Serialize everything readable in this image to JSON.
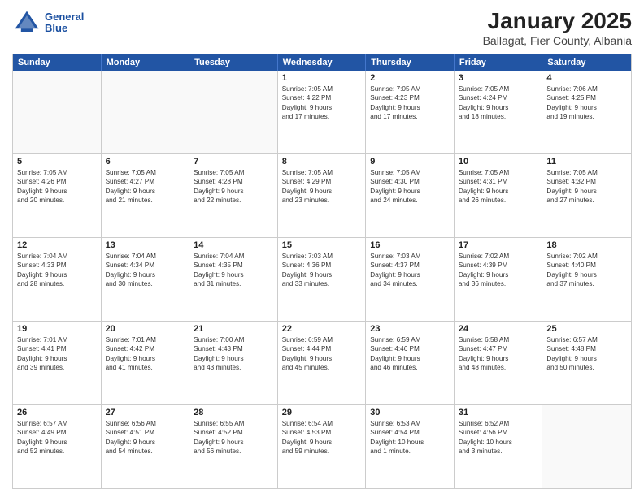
{
  "logo": {
    "line1": "General",
    "line2": "Blue"
  },
  "title": "January 2025",
  "subtitle": "Ballagat, Fier County, Albania",
  "days": [
    "Sunday",
    "Monday",
    "Tuesday",
    "Wednesday",
    "Thursday",
    "Friday",
    "Saturday"
  ],
  "rows": [
    [
      {
        "day": "",
        "info": ""
      },
      {
        "day": "",
        "info": ""
      },
      {
        "day": "",
        "info": ""
      },
      {
        "day": "1",
        "info": "Sunrise: 7:05 AM\nSunset: 4:22 PM\nDaylight: 9 hours\nand 17 minutes."
      },
      {
        "day": "2",
        "info": "Sunrise: 7:05 AM\nSunset: 4:23 PM\nDaylight: 9 hours\nand 17 minutes."
      },
      {
        "day": "3",
        "info": "Sunrise: 7:05 AM\nSunset: 4:24 PM\nDaylight: 9 hours\nand 18 minutes."
      },
      {
        "day": "4",
        "info": "Sunrise: 7:06 AM\nSunset: 4:25 PM\nDaylight: 9 hours\nand 19 minutes."
      }
    ],
    [
      {
        "day": "5",
        "info": "Sunrise: 7:05 AM\nSunset: 4:26 PM\nDaylight: 9 hours\nand 20 minutes."
      },
      {
        "day": "6",
        "info": "Sunrise: 7:05 AM\nSunset: 4:27 PM\nDaylight: 9 hours\nand 21 minutes."
      },
      {
        "day": "7",
        "info": "Sunrise: 7:05 AM\nSunset: 4:28 PM\nDaylight: 9 hours\nand 22 minutes."
      },
      {
        "day": "8",
        "info": "Sunrise: 7:05 AM\nSunset: 4:29 PM\nDaylight: 9 hours\nand 23 minutes."
      },
      {
        "day": "9",
        "info": "Sunrise: 7:05 AM\nSunset: 4:30 PM\nDaylight: 9 hours\nand 24 minutes."
      },
      {
        "day": "10",
        "info": "Sunrise: 7:05 AM\nSunset: 4:31 PM\nDaylight: 9 hours\nand 26 minutes."
      },
      {
        "day": "11",
        "info": "Sunrise: 7:05 AM\nSunset: 4:32 PM\nDaylight: 9 hours\nand 27 minutes."
      }
    ],
    [
      {
        "day": "12",
        "info": "Sunrise: 7:04 AM\nSunset: 4:33 PM\nDaylight: 9 hours\nand 28 minutes."
      },
      {
        "day": "13",
        "info": "Sunrise: 7:04 AM\nSunset: 4:34 PM\nDaylight: 9 hours\nand 30 minutes."
      },
      {
        "day": "14",
        "info": "Sunrise: 7:04 AM\nSunset: 4:35 PM\nDaylight: 9 hours\nand 31 minutes."
      },
      {
        "day": "15",
        "info": "Sunrise: 7:03 AM\nSunset: 4:36 PM\nDaylight: 9 hours\nand 33 minutes."
      },
      {
        "day": "16",
        "info": "Sunrise: 7:03 AM\nSunset: 4:37 PM\nDaylight: 9 hours\nand 34 minutes."
      },
      {
        "day": "17",
        "info": "Sunrise: 7:02 AM\nSunset: 4:39 PM\nDaylight: 9 hours\nand 36 minutes."
      },
      {
        "day": "18",
        "info": "Sunrise: 7:02 AM\nSunset: 4:40 PM\nDaylight: 9 hours\nand 37 minutes."
      }
    ],
    [
      {
        "day": "19",
        "info": "Sunrise: 7:01 AM\nSunset: 4:41 PM\nDaylight: 9 hours\nand 39 minutes."
      },
      {
        "day": "20",
        "info": "Sunrise: 7:01 AM\nSunset: 4:42 PM\nDaylight: 9 hours\nand 41 minutes."
      },
      {
        "day": "21",
        "info": "Sunrise: 7:00 AM\nSunset: 4:43 PM\nDaylight: 9 hours\nand 43 minutes."
      },
      {
        "day": "22",
        "info": "Sunrise: 6:59 AM\nSunset: 4:44 PM\nDaylight: 9 hours\nand 45 minutes."
      },
      {
        "day": "23",
        "info": "Sunrise: 6:59 AM\nSunset: 4:46 PM\nDaylight: 9 hours\nand 46 minutes."
      },
      {
        "day": "24",
        "info": "Sunrise: 6:58 AM\nSunset: 4:47 PM\nDaylight: 9 hours\nand 48 minutes."
      },
      {
        "day": "25",
        "info": "Sunrise: 6:57 AM\nSunset: 4:48 PM\nDaylight: 9 hours\nand 50 minutes."
      }
    ],
    [
      {
        "day": "26",
        "info": "Sunrise: 6:57 AM\nSunset: 4:49 PM\nDaylight: 9 hours\nand 52 minutes."
      },
      {
        "day": "27",
        "info": "Sunrise: 6:56 AM\nSunset: 4:51 PM\nDaylight: 9 hours\nand 54 minutes."
      },
      {
        "day": "28",
        "info": "Sunrise: 6:55 AM\nSunset: 4:52 PM\nDaylight: 9 hours\nand 56 minutes."
      },
      {
        "day": "29",
        "info": "Sunrise: 6:54 AM\nSunset: 4:53 PM\nDaylight: 9 hours\nand 59 minutes."
      },
      {
        "day": "30",
        "info": "Sunrise: 6:53 AM\nSunset: 4:54 PM\nDaylight: 10 hours\nand 1 minute."
      },
      {
        "day": "31",
        "info": "Sunrise: 6:52 AM\nSunset: 4:56 PM\nDaylight: 10 hours\nand 3 minutes."
      },
      {
        "day": "",
        "info": ""
      }
    ]
  ]
}
